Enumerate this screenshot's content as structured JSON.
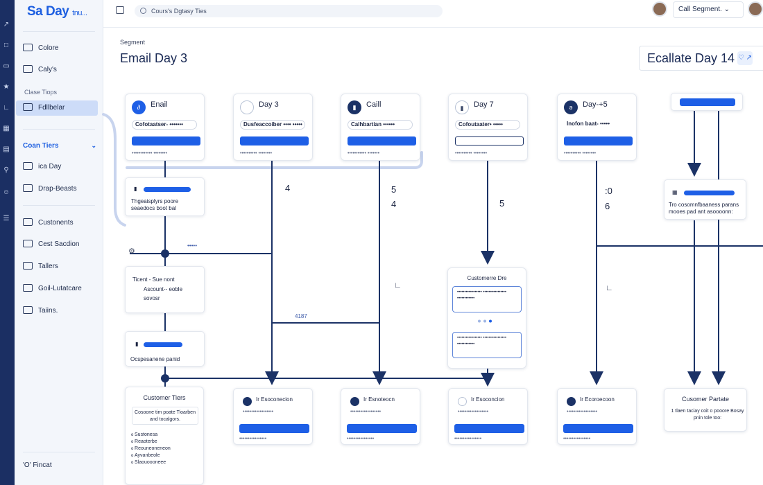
{
  "app": {
    "logo": "Sa Day",
    "logo_suffix": "tnu..."
  },
  "search": {
    "placeholder": "Cours's Dgtasy Ties"
  },
  "header": {
    "segment_dropdown": "Call Segment."
  },
  "sidebar": {
    "items": [
      {
        "label": "Colore"
      },
      {
        "label": "Caly's"
      }
    ],
    "section_label": "Clase Tiops",
    "active": "Fdllbelar",
    "section_title": "Coan Tiers",
    "items2": [
      {
        "label": "ica Day"
      },
      {
        "label": "Drap-Beasts"
      },
      {
        "label": "Custonents"
      },
      {
        "label": "Cest Sacdion"
      },
      {
        "label": "Tallers"
      },
      {
        "label": "Goil-Lutatcare"
      },
      {
        "label": "Taiins."
      }
    ],
    "footer": "'O' Fincat"
  },
  "page": {
    "breadcrumb": "Segment",
    "title": "Email Day 3",
    "escalate": "Ecallate Day 14"
  },
  "cards": [
    {
      "icon": "∂",
      "title": "Enail",
      "pill": "Cofotaatser- •••••••",
      "caption": "•••••••••••• ••••••••"
    },
    {
      "icon": "",
      "title": "Day 3",
      "pill": "Dusfeaccoiber •••• •••••",
      "caption": "•••••••••• ••••••••"
    },
    {
      "icon": "▮",
      "title": "Caill",
      "pill": "Calhbartian ••••••",
      "caption": "••••••••••• •••••••"
    },
    {
      "icon": "▮",
      "title": "Day 7",
      "pill": "Cofoutaater• •••••",
      "caption": "•••••••••• ••••••••"
    },
    {
      "icon": "ə",
      "title": "Day-+5",
      "pill": "Inofon baat- •••••",
      "caption": "•••••••••• ••••••••"
    }
  ],
  "minis": {
    "m1": "Thgeaisplyrs poore",
    "m1b": "seaedocs boot bal",
    "m2a": "Ticent - Sue nont",
    "m2b": "Ascount-- eoble",
    "m2c": "sovosr",
    "m3": "Ocspesanene panid",
    "right1": "Tro cosomnfbaaness parans",
    "right2": "mooes pad ant asoooonn:"
  },
  "labels": {
    "n4a": "4",
    "n5a": "5",
    "n4b": "4",
    "n5b": "5",
    "n0": ":0",
    "n6": "6",
    "tick1": "•••••",
    "tick2": "4187"
  },
  "customer_tiers": {
    "title": "Customer Tiers",
    "box": "Cosoone tim poate Tioarben and tocalgors.",
    "list": [
      "Sustonesa",
      "Reaoterbe",
      "Reouneoneneon",
      "Ayvanbeole",
      "Slaouoooneee"
    ]
  },
  "customer_dre": {
    "title": "Customerre Dre",
    "sub1": "••••••••••••••••• •••••••••••••••• ••••••••••••",
    "sub2": "••••••••••••••••• •••••••••••••••• ••••••••••••"
  },
  "customer_partate": {
    "title": "Cusomer Partate",
    "text": "1 tlaen taciay coit o pooore Bosay pnin tole too:"
  },
  "bottom_cards": [
    {
      "title": "Ir Esoconecion",
      "lines": "••••••••••••••••••",
      "cap": "••••••••••••••••"
    },
    {
      "title": "Ir Esnoteocn",
      "lines": "••••••••••••••••••",
      "cap": "••••••••••••••••"
    },
    {
      "title": "Ir Esoconcion",
      "lines": "••••••••••••••••••",
      "cap": "••••••••••••••••"
    },
    {
      "title": "Ir Ecoroecoon",
      "lines": "••••••••••••••••••",
      "cap": "••••••••••••••••"
    }
  ],
  "colors": {
    "accent": "#1e5fe6",
    "navy": "#1b3266",
    "rail": "#1b2f63"
  }
}
